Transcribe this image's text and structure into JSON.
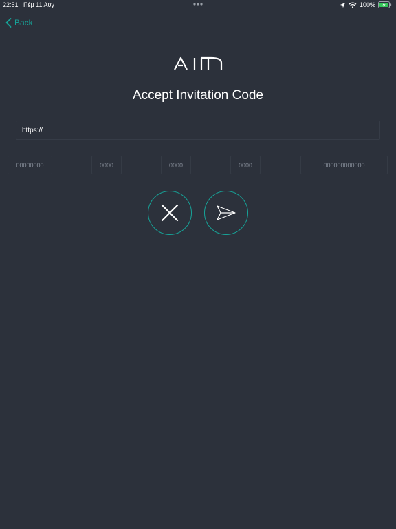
{
  "status_bar": {
    "time": "22:51",
    "date": "Πέμ 11 Αυγ",
    "battery": "100%"
  },
  "nav": {
    "back_label": "Back"
  },
  "logo": {
    "text": "AIM"
  },
  "page": {
    "title": "Accept Invitation Code"
  },
  "url_field": {
    "value": "https://"
  },
  "code_fields": [
    {
      "placeholder": "00000000"
    },
    {
      "placeholder": "0000"
    },
    {
      "placeholder": "0000"
    },
    {
      "placeholder": "0000"
    },
    {
      "placeholder": "000000000000"
    }
  ],
  "actions": {
    "cancel_icon": "close-icon",
    "send_icon": "paper-plane-icon"
  },
  "colors": {
    "background": "#2c313b",
    "accent": "#17a398",
    "text": "#ffffff",
    "placeholder": "#858c97"
  }
}
